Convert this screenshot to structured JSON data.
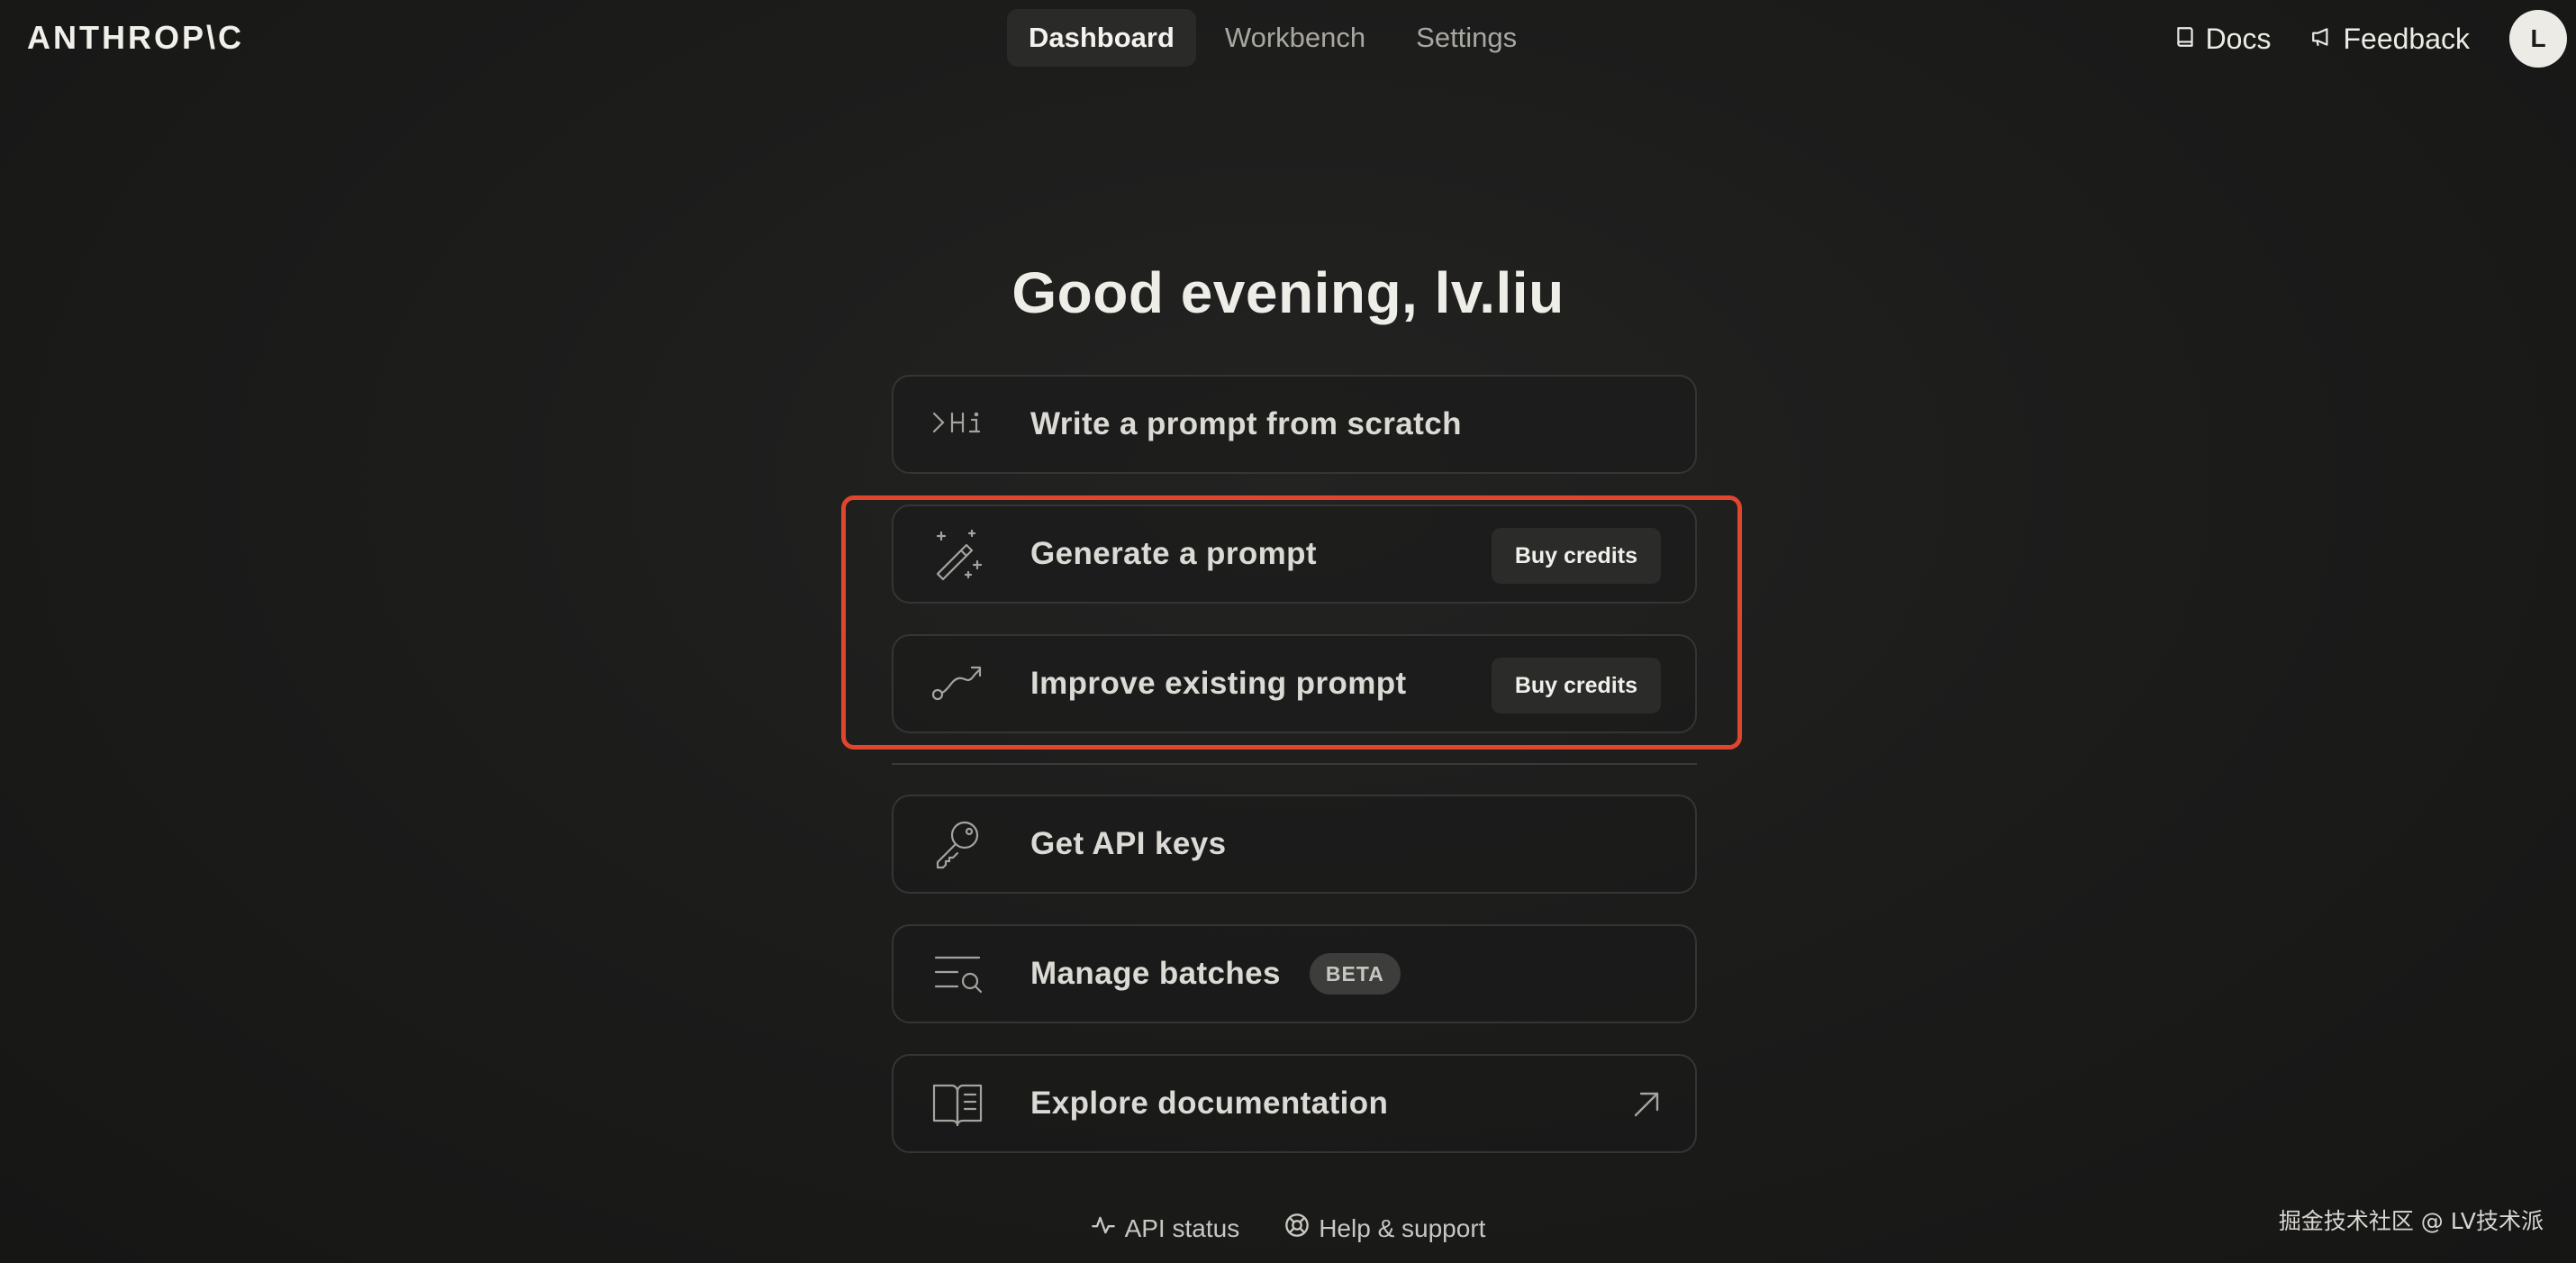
{
  "brand": {
    "logo_text": "ANTHROP\\C"
  },
  "nav": {
    "tabs": [
      {
        "label": "Dashboard",
        "active": true
      },
      {
        "label": "Workbench",
        "active": false
      },
      {
        "label": "Settings",
        "active": false
      }
    ]
  },
  "top_links": {
    "docs": "Docs",
    "feedback": "Feedback",
    "avatar_initial": "L"
  },
  "greeting": "Good evening, lv.liu",
  "actions": {
    "write_prompt": {
      "label": "Write a prompt from scratch",
      "icon": "prompt-hi-icon"
    },
    "generate_prompt": {
      "label": "Generate a prompt",
      "icon": "magic-wand-icon",
      "button": "Buy credits"
    },
    "improve_prompt": {
      "label": "Improve existing prompt",
      "icon": "curve-arrow-icon",
      "button": "Buy credits"
    },
    "api_keys": {
      "label": "Get API keys",
      "icon": "key-icon"
    },
    "batches": {
      "label": "Manage batches",
      "badge": "BETA",
      "icon": "list-search-icon"
    },
    "documentation": {
      "label": "Explore documentation",
      "icon": "book-icon"
    }
  },
  "footer": {
    "api_status": "API status",
    "help": "Help & support"
  },
  "watermark": "掘金技术社区 @ LV技术派",
  "colors": {
    "highlight": "#e0452e",
    "background": "#1c1c1b",
    "card_border": "#353533"
  }
}
